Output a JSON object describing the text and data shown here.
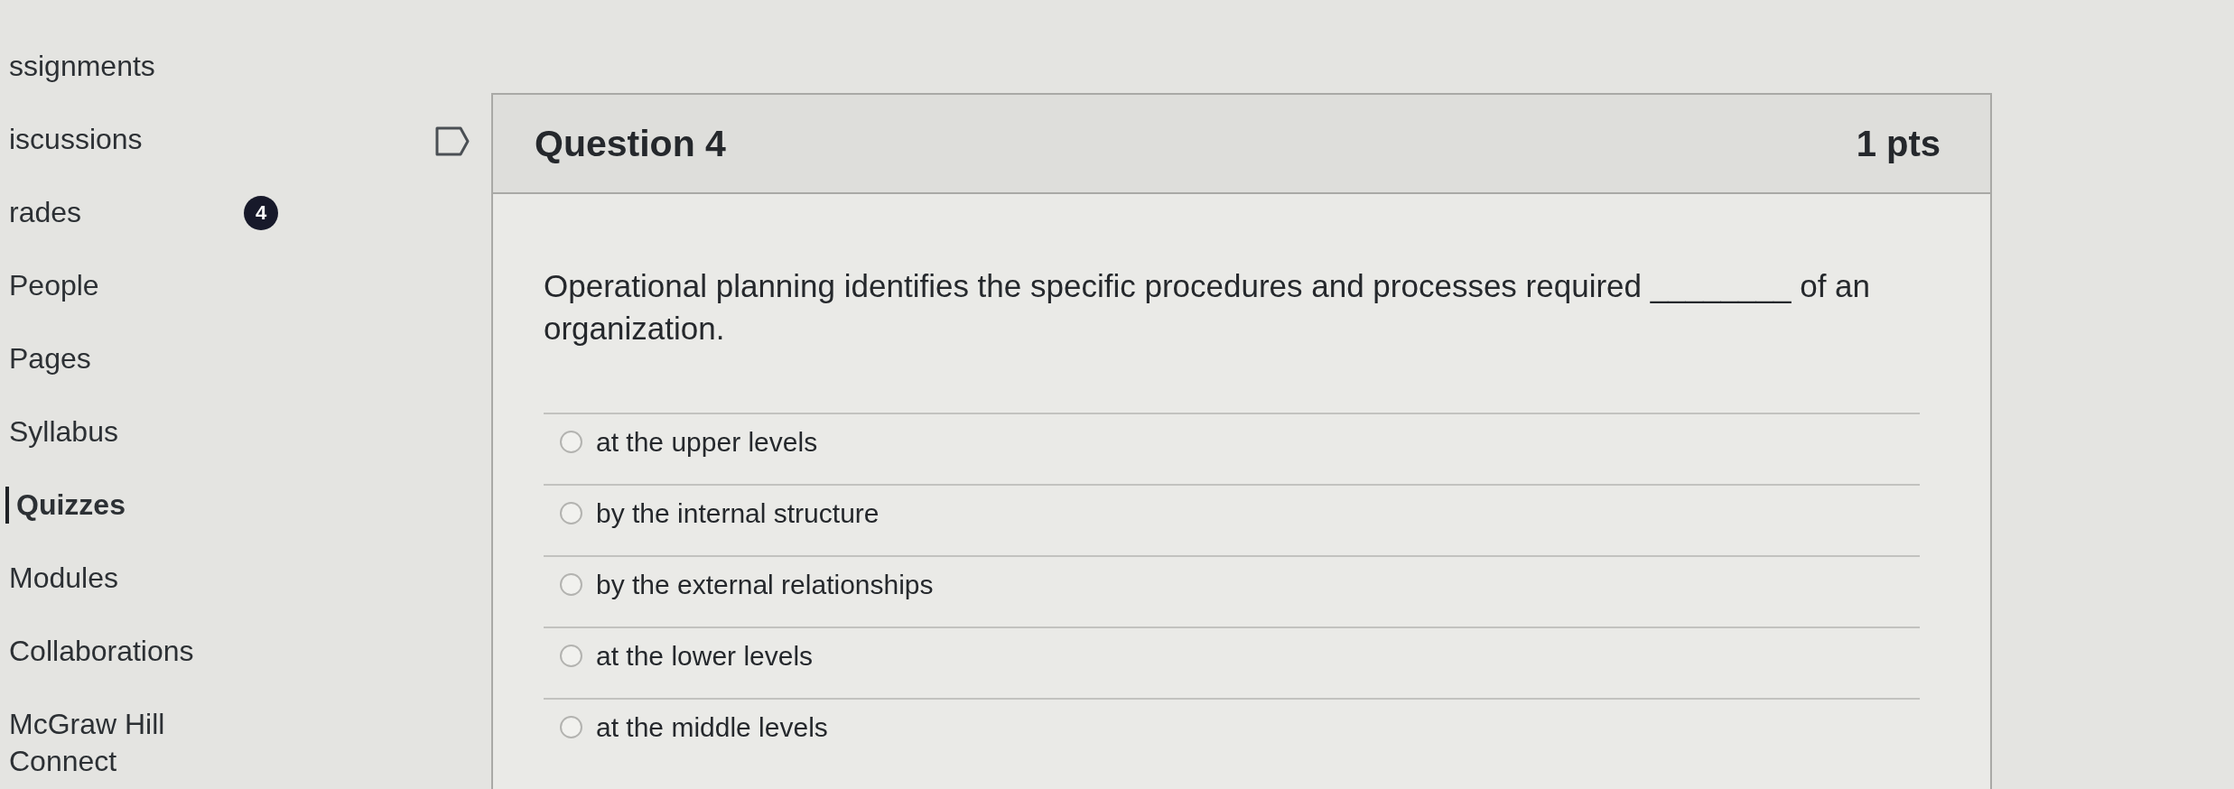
{
  "sidebar": {
    "items": [
      {
        "label": "ssignments",
        "selected": false
      },
      {
        "label": "iscussions",
        "selected": false
      },
      {
        "label": "rades",
        "selected": false,
        "badge": "4"
      },
      {
        "label": "People",
        "selected": false
      },
      {
        "label": "Pages",
        "selected": false
      },
      {
        "label": "Syllabus",
        "selected": false
      },
      {
        "label": "Quizzes",
        "selected": true
      },
      {
        "label": "Modules",
        "selected": false
      },
      {
        "label": "Collaborations",
        "selected": false
      },
      {
        "label": "McGraw Hill Connect",
        "selected": false
      }
    ]
  },
  "question": {
    "flagged": false,
    "title": "Question 4",
    "points": "1 pts",
    "text": "Operational planning identifies the specific procedures and processes required ________ of an organization.",
    "answers": [
      {
        "label": "at the upper levels",
        "selected": false
      },
      {
        "label": "by the internal structure",
        "selected": false
      },
      {
        "label": "by the external relationships",
        "selected": false
      },
      {
        "label": "at the lower levels",
        "selected": false
      },
      {
        "label": "at the middle levels",
        "selected": false
      }
    ]
  }
}
